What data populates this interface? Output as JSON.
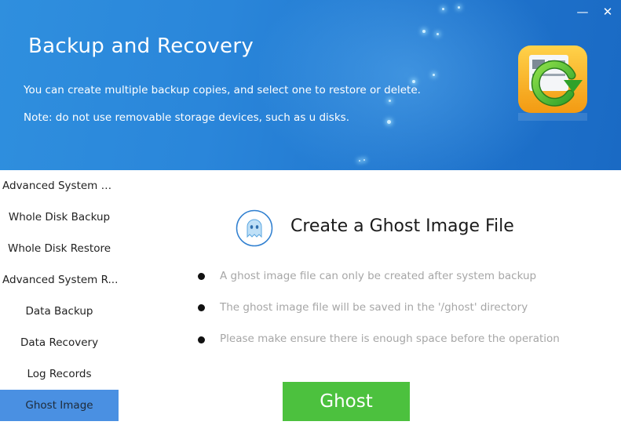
{
  "header": {
    "title": "Backup and Recovery",
    "description_line1": "You can create multiple backup copies, and select one to restore or delete.",
    "description_line2": "Note: do not use removable storage devices, such as u disks.",
    "minimize_label": "—",
    "close_label": "✕"
  },
  "sidebar": {
    "items": [
      {
        "label": "Advanced System Ba..."
      },
      {
        "label": "Whole Disk Backup"
      },
      {
        "label": "Whole Disk Restore"
      },
      {
        "label": "Advanced System R..."
      },
      {
        "label": "Data Backup"
      },
      {
        "label": "Data Recovery"
      },
      {
        "label": "Log Records"
      },
      {
        "label": "Ghost Image"
      }
    ],
    "active_item": "Ghost Image"
  },
  "main": {
    "title": "Create a Ghost Image File",
    "bullets": [
      "A ghost image file can only be created after system backup",
      "The ghost image file will be saved in the '/ghost' directory",
      "Please make ensure there is enough space before the operation"
    ],
    "action_button": "Ghost"
  },
  "colors": {
    "header_blue": "#2a86da",
    "sidebar_active": "#4a90e2",
    "action_green": "#4cc13e"
  }
}
